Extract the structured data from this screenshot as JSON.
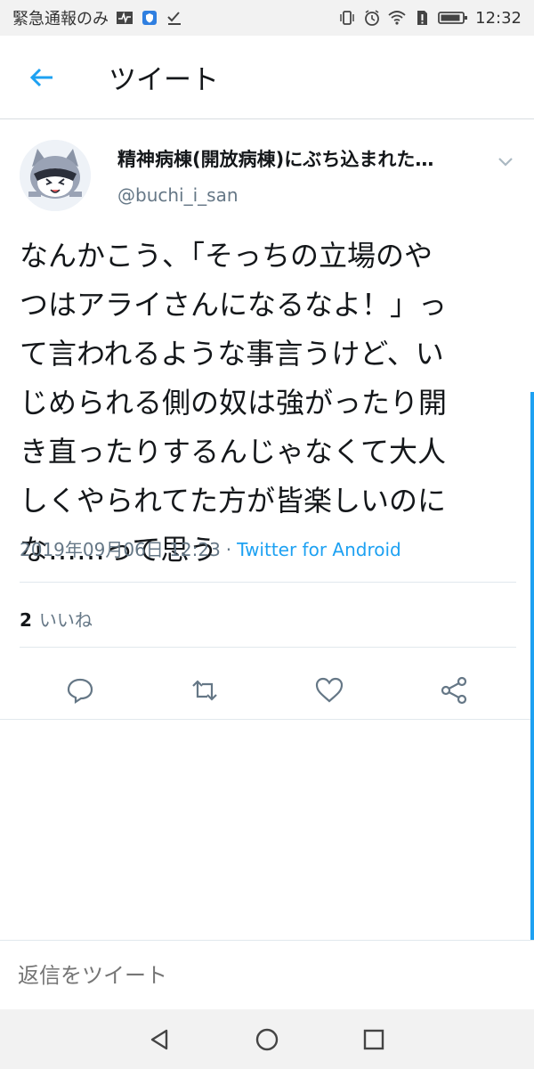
{
  "status_bar": {
    "carrier": "緊急通報のみ",
    "time": "12:32"
  },
  "header": {
    "title": "ツイート"
  },
  "tweet": {
    "display_name": "精神病棟(開放病棟)にぶち込まれた…",
    "username": "@buchi_i_san",
    "text": "なんかこう、「そっちの立場のや\nつはアライさんになるなよ！」っ\nて言われるような事言うけど、い\nじめられる側の奴は強がったり開\nき直ったりするんじゃなくて大人\nしくやられてた方が皆楽しいのに\nな……って思う",
    "timestamp": "2019年09月06日 12:23",
    "separator": "·",
    "source": "Twitter for Android",
    "like_count": "2",
    "like_label": "いいね"
  },
  "reply": {
    "placeholder": "返信をツイート"
  },
  "colors": {
    "accent": "#1da1f2",
    "secondary_text": "#657786",
    "primary_text": "#14171a"
  }
}
